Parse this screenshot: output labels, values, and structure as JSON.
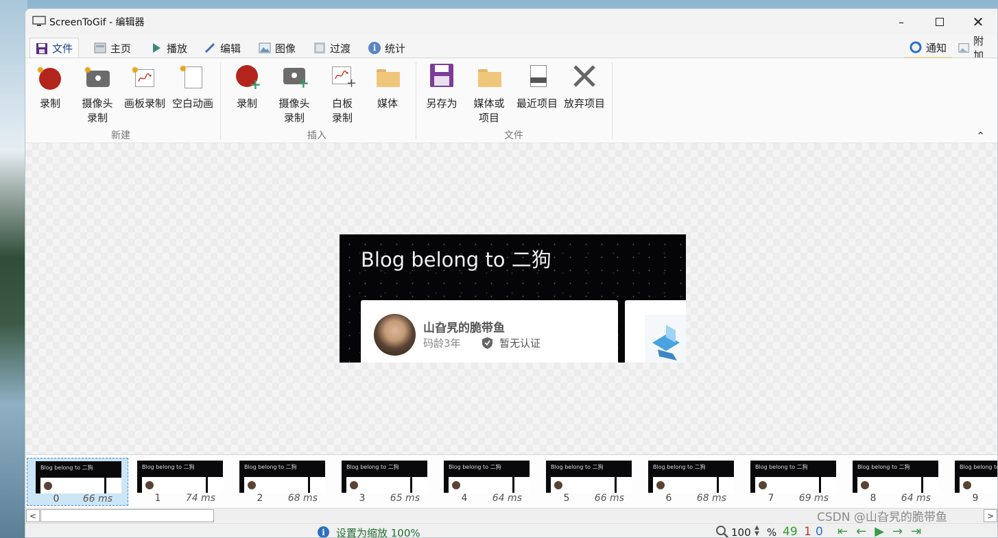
{
  "window": {
    "title": "ScreenToGif - 编辑器"
  },
  "tabs": [
    {
      "label": "文件",
      "icon": "save-icon",
      "active": true
    },
    {
      "label": "主页",
      "icon": "home-icon"
    },
    {
      "label": "播放",
      "icon": "play-icon"
    },
    {
      "label": "编辑",
      "icon": "pencil-icon"
    },
    {
      "label": "图像",
      "icon": "image-icon"
    },
    {
      "label": "过渡",
      "icon": "transition-icon"
    },
    {
      "label": "统计",
      "icon": "info-icon"
    }
  ],
  "right_tabs": [
    {
      "label": "通知",
      "icon": "refresh-icon"
    },
    {
      "label": "附加",
      "icon": "extras-icon"
    }
  ],
  "ribbon": {
    "groups": [
      {
        "label": "新建",
        "buttons": [
          {
            "label": "录制",
            "icon": "record-icon"
          },
          {
            "label": "摄像头\n录制",
            "icon": "camera-icon"
          },
          {
            "label": "画板录制",
            "icon": "board-icon"
          },
          {
            "label": "空白动画",
            "icon": "blank-page-icon"
          }
        ]
      },
      {
        "label": "插入",
        "buttons": [
          {
            "label": "录制",
            "icon": "record-add-icon"
          },
          {
            "label": "摄像头\n录制",
            "icon": "camera-add-icon"
          },
          {
            "label": "白板\n录制",
            "icon": "board-add-icon"
          },
          {
            "label": "媒体",
            "icon": "folder-icon"
          }
        ]
      },
      {
        "label": "文件",
        "buttons": [
          {
            "label": "另存为",
            "icon": "floppy-icon"
          },
          {
            "label": "媒体或\n项目",
            "icon": "open-folder-icon"
          },
          {
            "label": "最近项目",
            "icon": "recent-icon"
          },
          {
            "label": "放弃项目",
            "icon": "discard-icon"
          }
        ]
      }
    ]
  },
  "preview": {
    "blog_title": "Blog belong to 二狗",
    "username": "山旮旯的脆带鱼",
    "age": "码龄3年",
    "cert": "暂无认证"
  },
  "frames": [
    {
      "index": "0",
      "delay": "66 ms",
      "selected": true
    },
    {
      "index": "1",
      "delay": "74 ms"
    },
    {
      "index": "2",
      "delay": "68 ms"
    },
    {
      "index": "3",
      "delay": "65 ms"
    },
    {
      "index": "4",
      "delay": "64 ms"
    },
    {
      "index": "5",
      "delay": "66 ms"
    },
    {
      "index": "6",
      "delay": "68 ms"
    },
    {
      "index": "7",
      "delay": "69 ms"
    },
    {
      "index": "8",
      "delay": "64 ms"
    },
    {
      "index": "9",
      "delay": ""
    }
  ],
  "thumb_title": "Blog belong to 二狗",
  "status": {
    "message": "设置为缩放 100%",
    "zoom": "100",
    "zoom_unit": "%",
    "frame_count": "49",
    "selected_count": "1",
    "current_index": "0"
  },
  "watermark": "CSDN @山旮旯的脆带鱼",
  "colors": {
    "accent": "#1a3f8a",
    "record_red": "#b3241c",
    "status_green": "#1f6d30"
  }
}
